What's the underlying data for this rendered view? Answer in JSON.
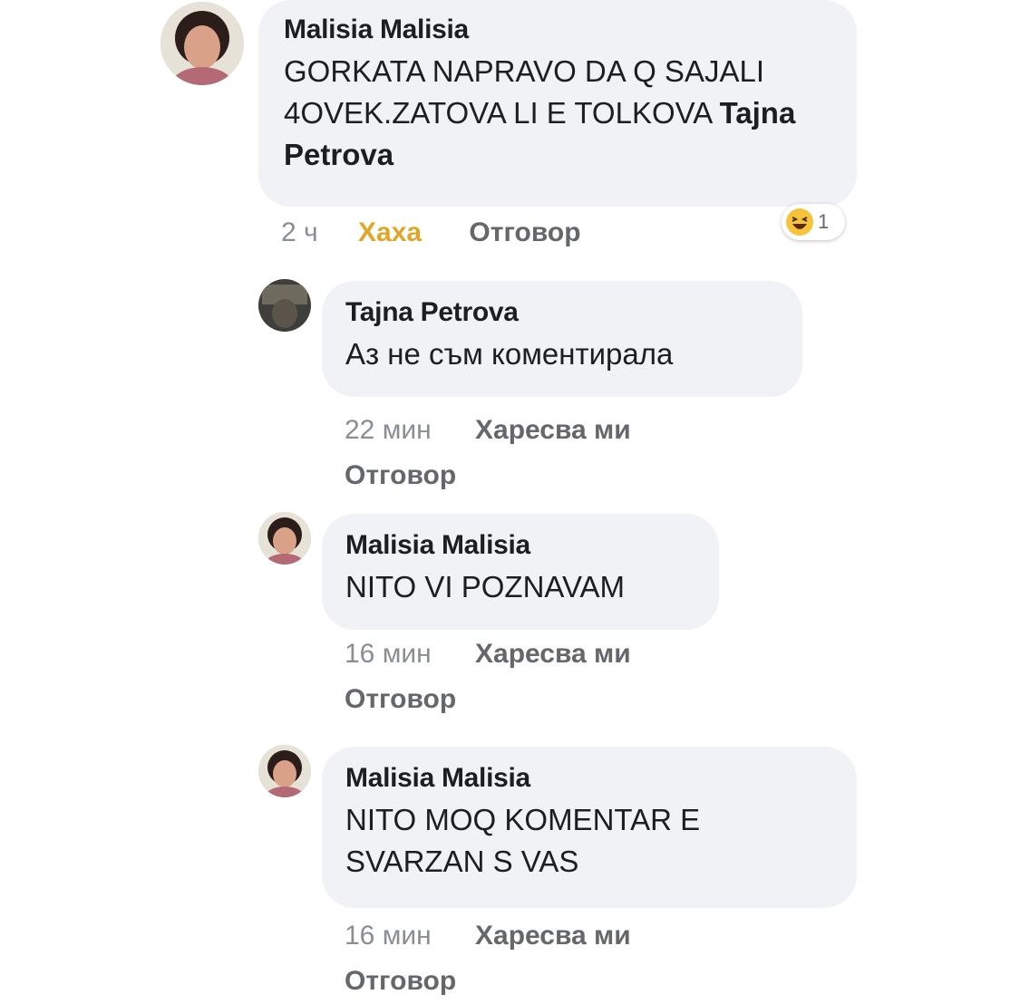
{
  "comments": [
    {
      "author": "Malisia Malisia",
      "text": "GORKATA NAPRAVO DA Q SAJALI 4OVEK.ZATOVA LI E TOLKOVA",
      "tag": "Tajna Petrova",
      "time": "2 ч",
      "reaction_label": "Хаха",
      "reply_label": "Отговор",
      "reaction_count": "1",
      "reaction_icon": "haha-emoji-icon"
    },
    {
      "author": "Tajna Petrova",
      "text": "Аз не съм коментирала",
      "time": "22 мин",
      "like_label": "Харесва ми",
      "reply_label": "Отговор"
    },
    {
      "author": "Malisia Malisia",
      "text": "NITO VI POZNAVAM",
      "time": "16 мин",
      "like_label": "Харесва ми",
      "reply_label": "Отговор"
    },
    {
      "author": "Malisia Malisia",
      "text": "NITO MOQ KOMENTAR E SVARZAN S VAS",
      "time": "16 мин",
      "like_label": "Харесва ми",
      "reply_label": "Отговор"
    }
  ],
  "colors": {
    "bubble": "#f0f2f5",
    "meta_text": "#65676b",
    "haha": "#e1a628"
  }
}
